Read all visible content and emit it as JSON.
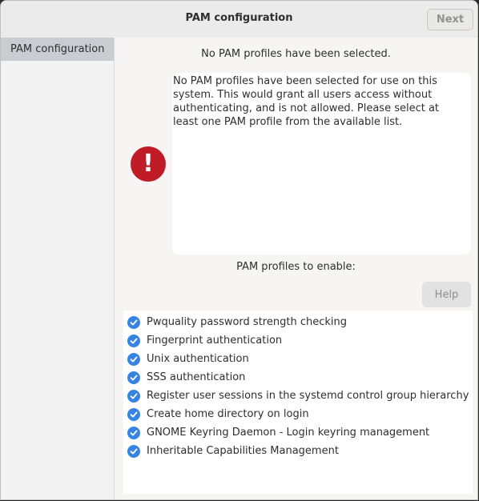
{
  "window": {
    "title": "PAM configuration",
    "next_label": "Next"
  },
  "sidebar": {
    "items": [
      {
        "label": "PAM configuration",
        "selected": true
      }
    ]
  },
  "main": {
    "warning_heading": "No PAM profiles have been selected.",
    "warning_icon": "error-exclamation-icon",
    "message": "No PAM profiles have been selected for use on this system. This would grant all users access without authenticating, and is not allowed. Please select at least one PAM profile from the available list.",
    "profiles_heading": "PAM profiles to enable:",
    "help_label": "Help",
    "profiles": [
      {
        "label": "Pwquality password strength checking",
        "checked": true
      },
      {
        "label": "Fingerprint authentication",
        "checked": true
      },
      {
        "label": "Unix authentication",
        "checked": true
      },
      {
        "label": "SSS authentication",
        "checked": true
      },
      {
        "label": "Register user sessions in the systemd control group hierarchy",
        "checked": true
      },
      {
        "label": "Create home directory on login",
        "checked": true
      },
      {
        "label": "GNOME Keyring Daemon - Login keyring management",
        "checked": true
      },
      {
        "label": "Inheritable Capabilities Management",
        "checked": true
      }
    ]
  },
  "colors": {
    "accent": "#3584e4",
    "error": "#c01c28",
    "sidebar_selected": "#c9cdd2"
  }
}
